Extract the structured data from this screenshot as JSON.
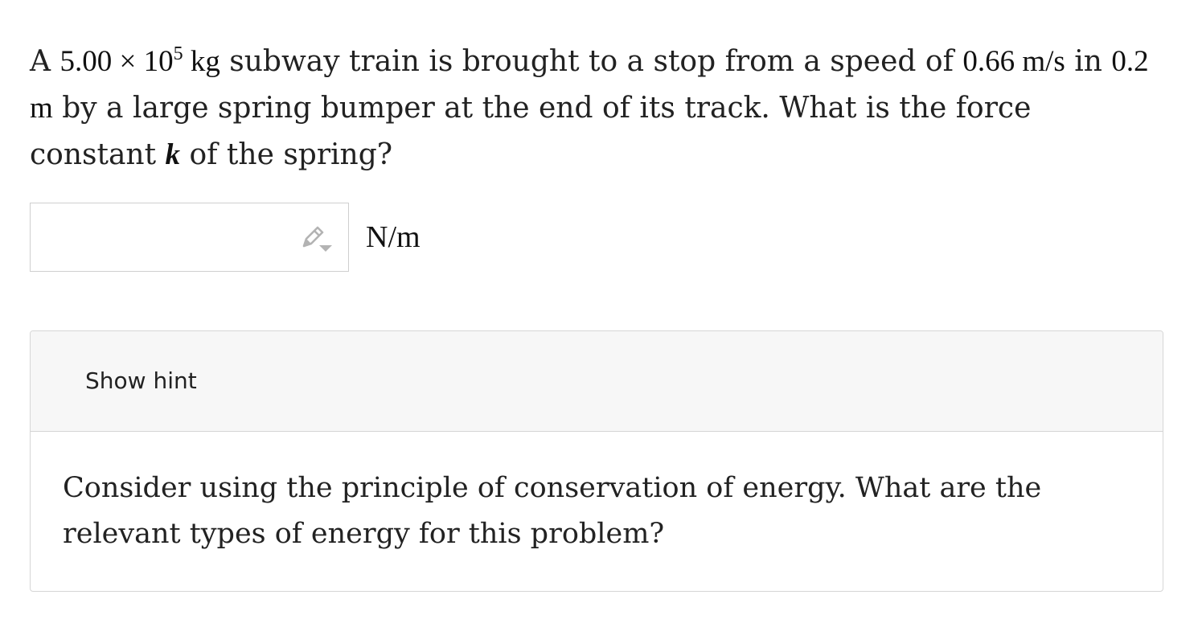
{
  "question": {
    "part1": "A ",
    "mass_coefficient": "5.00",
    "times": "×",
    "ten": "10",
    "mass_exponent": "5",
    "mass_unit": "kg",
    "part2": " subway train is brought to a stop from a speed of ",
    "speed_value": "0.66",
    "speed_unit": "m/s",
    "part3": " in ",
    "distance_value": "0.2",
    "distance_unit": "m",
    "part4": " by a large spring bumper at the end of its track. What is the force constant ",
    "variable": "k",
    "part5": " of the spring?"
  },
  "answer": {
    "value": "",
    "placeholder": "",
    "unit": "N/m",
    "edit_icon": "pencil-dropdown-icon"
  },
  "hint": {
    "toggle_label": "Show hint",
    "text": "Consider using the principle of conservation of energy. What are the relevant types of energy for this problem?"
  },
  "colors": {
    "text": "#222222",
    "border": "#cfcfcf",
    "hint_header_bg": "#f7f7f7",
    "icon": "#b3b3b3"
  }
}
